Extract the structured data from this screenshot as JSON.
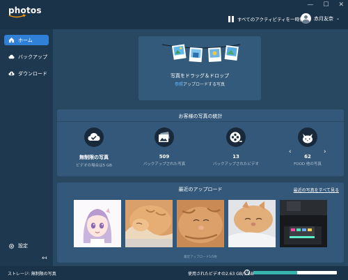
{
  "app": {
    "logo_text": "photos"
  },
  "window_controls": {
    "minimize": "—",
    "maximize": "☐",
    "close": "✕"
  },
  "header": {
    "pause_label": "すべてのアクティビティを一時停止",
    "user_name": "赤月友奈"
  },
  "sidebar": {
    "items": [
      {
        "label": "ホーム",
        "icon": "home-icon",
        "active": true
      },
      {
        "label": "バックアップ",
        "icon": "cloud-icon",
        "active": false
      },
      {
        "label": "ダウンロード",
        "icon": "download-icon",
        "active": false
      }
    ],
    "settings_label": "設定",
    "collapse_glyph": "↤"
  },
  "upload": {
    "title": "写真をドラッグ＆ドロップ",
    "link_text": "参照",
    "sub_text": "アップロードする写真"
  },
  "stats": {
    "title": "お客様の写真の統計",
    "items": [
      {
        "value": "無制限の写真",
        "label": "ビデオの場合は5 GB",
        "icon": "cloud-check-icon"
      },
      {
        "value": "509",
        "label": "バックアップされた写真",
        "icon": "photo-icon"
      },
      {
        "value": "13",
        "label": "バックアップされたビデオ",
        "icon": "film-reel-icon"
      },
      {
        "value": "62",
        "label": "FOOD 他の写真",
        "icon": "cat-icon"
      }
    ],
    "prev_glyph": "‹",
    "next_glyph": "›"
  },
  "recent": {
    "title": "最近のアップロード",
    "see_all": "最近の写真をすべて見る",
    "footer_text": "最近アップロード5/5枚",
    "photos": [
      {
        "name": "anime-girl-photo"
      },
      {
        "name": "cat-photo-1"
      },
      {
        "name": "cat-photo-2"
      },
      {
        "name": "cat-photo-3"
      },
      {
        "name": "device-photo"
      }
    ]
  },
  "footer": {
    "storage_label": "ストレージ: 無制限の写真",
    "usage_text": "使用されたビデオの2.63 GB/5 GB",
    "help_glyph": "?",
    "usage_fraction": 0.526
  },
  "colors": {
    "accent": "#2f80d6",
    "usage_bar": "#37b6ae",
    "link": "#6cb4ff"
  }
}
